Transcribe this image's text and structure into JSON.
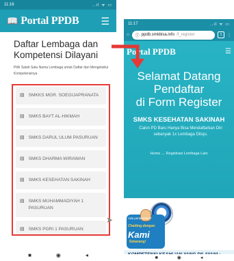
{
  "left": {
    "status": {
      "time": "11:16",
      "icons": "..ıl ᯤ ▭"
    },
    "nav": {
      "brand": "Portal PPDB",
      "brand_icon": "book-icon",
      "menu_icon": "hamburger-menu-icon"
    },
    "heading": "Daftar Lembaga dan Kompetensi Dilayani",
    "subtitle": "Pilih Salah Satu Nama Lembaga untuk Daftar dan Mengetahui Kompetensinya",
    "schools": [
      "SMKKS MGR. SOEGIJAPRANATA",
      "SMKS BAYT AL-HIKMAH",
      "SMKS DARUL ULUM PASURUAN",
      "SMKS DHARMA WIRAWAN",
      "SMKS KESEHATAN SAKINAH",
      "SMKS MUHAMMADIYAH 1 PASURUAN",
      "SMKS PGRI 1 PASURUAN"
    ],
    "navbar": {
      "recent": "■",
      "home": "◉",
      "back": "◂"
    },
    "accent": "#1f9fb6",
    "highlight": "#e53935"
  },
  "right": {
    "status": {
      "time": "11:17",
      "icons": "..ıl ᯤ ▭"
    },
    "browser": {
      "url_domain": "ppdb.smkbisa.info",
      "url_path": "/f_register",
      "tabs": "1",
      "more": "⋮",
      "home": "⌂"
    },
    "nav": {
      "brand": "Portal PPDB",
      "menu_icon": "hamburger-menu-icon"
    },
    "welcome": [
      "Selamat Datang",
      "Pendaftar",
      "di Form Register"
    ],
    "school": "SMKS KESEHATAN SAKINAH",
    "school_note": "Calon PD Baru Hanya Bisa Mendaftarkan Diri sebanyak 1x Lembaga Dituju.",
    "breadcrumb": "Home → Registrasi Lembaga Lain",
    "promo": {
      "top": "Ada pertanyaan?",
      "line1": "Chatting dengan",
      "line2": "Kami",
      "line3": "Sekarang!"
    },
    "section_title": "KOMPETENSI KEAHLIAN YANG DILAYANI :",
    "navbar": {
      "recent": "■",
      "home": "◉",
      "back": "◂"
    },
    "accent": "#28b3c4"
  }
}
